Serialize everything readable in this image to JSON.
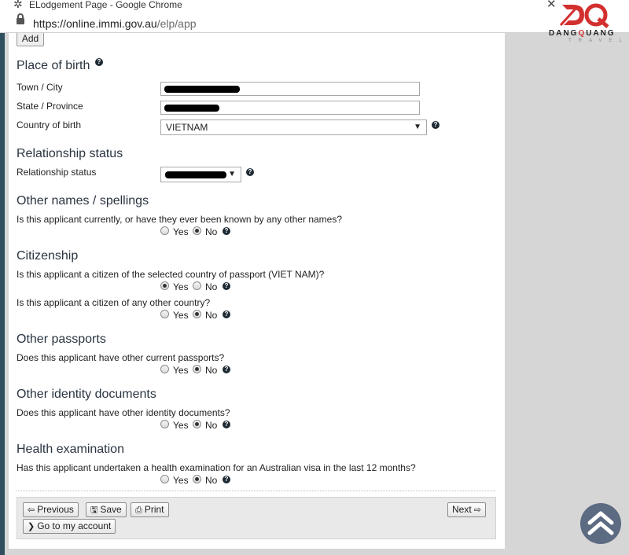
{
  "browser": {
    "window_title": "ELodgement Page - Google Chrome",
    "url_host": "https://online.immi.gov.au",
    "url_path": "/elp/app"
  },
  "logo": {
    "brand_prefix": "DANG",
    "brand_q": "Q",
    "brand_suffix": "UANG",
    "sub": "TRAVEL",
    "color": "#d32f2f"
  },
  "toolbar": {
    "add_label": "Add"
  },
  "place_of_birth": {
    "title": "Place of birth",
    "town_label": "Town / City",
    "state_label": "State / Province",
    "country_label": "Country of birth",
    "country_value": "VIETNAM"
  },
  "relationship": {
    "title": "Relationship status",
    "label": "Relationship status"
  },
  "other_names": {
    "title": "Other names / spellings",
    "question": "Is this applicant currently, or have they ever been known by any other names?"
  },
  "citizenship": {
    "title": "Citizenship",
    "question1": "Is this applicant a citizen of the selected country of passport (VIET NAM)?",
    "question2": "Is this applicant a citizen of any other country?"
  },
  "other_passports": {
    "title": "Other passports",
    "question": "Does this applicant have other current passports?"
  },
  "identity_docs": {
    "title": "Other identity documents",
    "question": "Does this applicant have other identity documents?"
  },
  "health": {
    "title": "Health examination",
    "question": "Has this applicant undertaken a health examination for an Australian visa in the last 12 months?"
  },
  "radio": {
    "yes": "Yes",
    "no": "No"
  },
  "help_glyph": "?",
  "footer": {
    "previous": "Previous",
    "save": "Save",
    "print": "Print",
    "next": "Next",
    "account": "Go to my account"
  },
  "colors": {
    "left_bar": "#2f4f5f",
    "scroll_button": "#5c6a82",
    "help_icon": "#1e2a33"
  }
}
